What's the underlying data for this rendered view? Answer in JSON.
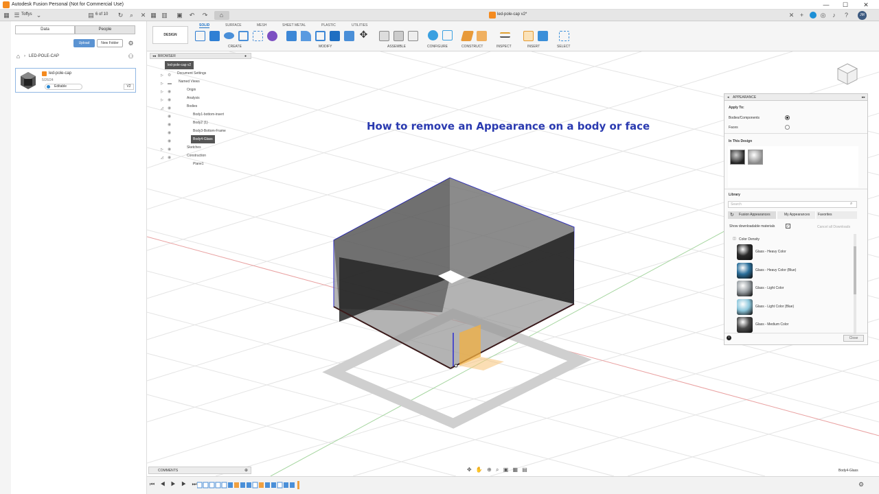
{
  "app": {
    "title": "Autodesk Fusion Personal (Not for Commercial Use)",
    "window_controls": [
      "—",
      "☐",
      "✕"
    ]
  },
  "appbar": {
    "user": "Toffys",
    "doc_count": "6 of 10",
    "doc_tab": "led-pole-cap v2*",
    "avatar": "JM"
  },
  "data_panel": {
    "tabs": [
      "Data",
      "People"
    ],
    "upload": "Upload",
    "new_folder": "New Folder",
    "breadcrumb": "LED-POLE-CAP",
    "file": {
      "name": "led-pole-cap",
      "date": "5/26/24",
      "status": "Editable",
      "version": "V2"
    }
  },
  "toolbar": {
    "workspace": "DESIGN",
    "tabs": [
      "SOLID",
      "SURFACE",
      "MESH",
      "SHEET METAL",
      "PLASTIC",
      "UTILITIES"
    ],
    "groups": [
      "CREATE",
      "MODIFY",
      "ASSEMBLE",
      "CONFIGURE",
      "CONSTRUCT",
      "INSPECT",
      "INSERT",
      "SELECT"
    ]
  },
  "browser": {
    "title": "BROWSER",
    "items": [
      {
        "label": "led-pole-cap v2"
      },
      {
        "label": "Document Settings"
      },
      {
        "label": "Named Views"
      },
      {
        "label": "Origin"
      },
      {
        "label": "Analysis"
      },
      {
        "label": "Bodies"
      },
      {
        "label": "Body1-bottom-insert"
      },
      {
        "label": "Body2 (1)"
      },
      {
        "label": "Body3-Bottom-Frame"
      },
      {
        "label": "Body4-Glass"
      },
      {
        "label": "Sketches"
      },
      {
        "label": "Construction"
      },
      {
        "label": "Plane1"
      }
    ]
  },
  "viewport": {
    "heading": "How to remove an Appearance on a body or face"
  },
  "appearance_panel": {
    "title": "APPEARANCE",
    "apply_to": "Apply To:",
    "option_bodies": "Bodies/Components",
    "option_faces": "Faces",
    "in_this_design": "In This Design",
    "library": "Library",
    "search_placeholder": "Search",
    "lib_tabs": [
      "Fusion Appearances",
      "My Appearances",
      "Favorites"
    ],
    "show_downloadable": "Show downloadable materials",
    "cancel_all": "Cancel all Downloads",
    "folder": "Color Density",
    "materials": [
      {
        "name": "Glass - Heavy Color",
        "color": "#2a2a2a"
      },
      {
        "name": "Glass - Heavy Color (Blue)",
        "color": "#2a6e9a"
      },
      {
        "name": "Glass - Light Color",
        "color": "#9aa0a4"
      },
      {
        "name": "Glass - Light Color (Blue)",
        "color": "#8dc7dc"
      },
      {
        "name": "Glass - Medium Color",
        "color": "#4a4a4a"
      }
    ],
    "close": "Close"
  },
  "comments": {
    "label": "COMMENTS"
  },
  "status": {
    "selection": "Body4-Glass"
  }
}
